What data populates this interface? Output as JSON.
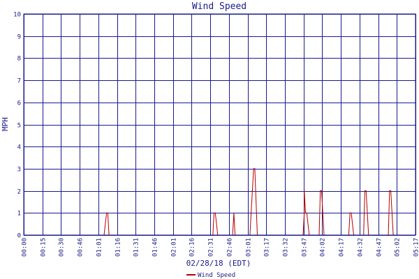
{
  "chart_data": {
    "type": "line",
    "title": "Wind Speed",
    "xlabel": "02/28/18 (EDT)",
    "ylabel": "MPH",
    "ylim": [
      0,
      10
    ],
    "y_ticks": [
      "0",
      "1",
      "2",
      "3",
      "4",
      "5",
      "6",
      "7",
      "8",
      "9",
      "10"
    ],
    "x_ticks": [
      "00:00",
      "00:15",
      "00:30",
      "00:46",
      "01:01",
      "01:16",
      "01:31",
      "01:46",
      "02:01",
      "02:16",
      "02:31",
      "02:46",
      "03:01",
      "03:17",
      "03:32",
      "03:47",
      "04:02",
      "04:17",
      "04:32",
      "04:47",
      "05:02",
      "05:17"
    ],
    "xlim": [
      "00:00",
      "05:17"
    ],
    "grid": true,
    "legend_position": "bottom-center",
    "colors": {
      "line": "#b30000",
      "grid": "#1a1a8c",
      "text": "#1a1a8c"
    },
    "series": [
      {
        "name": "Wind Speed",
        "x": [
          "00:00",
          "01:05",
          "01:07",
          "01:08",
          "01:09",
          "01:11",
          "02:33",
          "02:34",
          "02:35",
          "02:37",
          "02:49",
          "02:50",
          "02:51",
          "02:53",
          "03:03",
          "03:04",
          "03:05",
          "03:06",
          "03:07",
          "03:09",
          "03:46",
          "03:47",
          "03:47",
          "03:48",
          "03:49",
          "03:51",
          "03:53",
          "03:59",
          "04:00",
          "04:01",
          "04:03",
          "04:23",
          "04:24",
          "04:25",
          "04:27",
          "04:35",
          "04:36",
          "04:37",
          "04:39",
          "04:55",
          "04:56",
          "04:57",
          "04:59",
          "05:17"
        ],
        "values": [
          0,
          0,
          1,
          1,
          0,
          0,
          0,
          1,
          1,
          0,
          0,
          1,
          0,
          0,
          0,
          1,
          2,
          3,
          3,
          0,
          0,
          1,
          2,
          1,
          1,
          0,
          0,
          0,
          2,
          2,
          0,
          0,
          1,
          1,
          0,
          0,
          2,
          2,
          0,
          0,
          2,
          2,
          0,
          0
        ]
      }
    ]
  }
}
